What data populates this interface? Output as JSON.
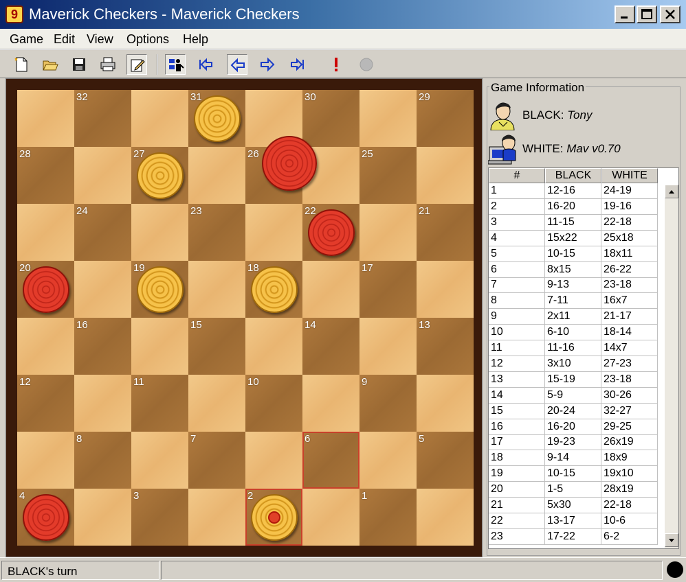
{
  "window": {
    "title": "Maverick Checkers - Maverick Checkers",
    "app_icon_letter": "9"
  },
  "menu": [
    "Game",
    "Edit",
    "View",
    "Options",
    "Help"
  ],
  "toolbar": {
    "buttons": [
      "new-document-icon",
      "open-folder-icon",
      "save-disk-icon",
      "print-icon",
      "edit-icon",
      "setup-pieces-icon",
      "first-move-icon",
      "back-move-icon",
      "forward-move-icon",
      "last-move-icon",
      "alert-icon",
      "stop-icon"
    ],
    "colors": {
      "arrow": "#1a3cc8",
      "alert": "#cc0000",
      "stop": "#b0b0b0"
    }
  },
  "board": {
    "size": 8,
    "colors": {
      "light": "#f2c98a",
      "dark": "#a6703a",
      "red_piece": "#e33b2a",
      "yellow_piece": "#f6c24a",
      "highlight": "#c8402a"
    },
    "squares": [
      {
        "n": 32,
        "row": 0,
        "col": 1
      },
      {
        "n": 31,
        "row": 0,
        "col": 3
      },
      {
        "n": 30,
        "row": 0,
        "col": 5
      },
      {
        "n": 29,
        "row": 0,
        "col": 7
      },
      {
        "n": 28,
        "row": 1,
        "col": 0
      },
      {
        "n": 27,
        "row": 1,
        "col": 2
      },
      {
        "n": 26,
        "row": 1,
        "col": 4
      },
      {
        "n": 25,
        "row": 1,
        "col": 6
      },
      {
        "n": 24,
        "row": 2,
        "col": 1
      },
      {
        "n": 23,
        "row": 2,
        "col": 3
      },
      {
        "n": 22,
        "row": 2,
        "col": 5
      },
      {
        "n": 21,
        "row": 2,
        "col": 7
      },
      {
        "n": 20,
        "row": 3,
        "col": 0
      },
      {
        "n": 19,
        "row": 3,
        "col": 2
      },
      {
        "n": 18,
        "row": 3,
        "col": 4
      },
      {
        "n": 17,
        "row": 3,
        "col": 6
      },
      {
        "n": 16,
        "row": 4,
        "col": 1
      },
      {
        "n": 15,
        "row": 4,
        "col": 3
      },
      {
        "n": 14,
        "row": 4,
        "col": 5
      },
      {
        "n": 13,
        "row": 4,
        "col": 7
      },
      {
        "n": 12,
        "row": 5,
        "col": 0
      },
      {
        "n": 11,
        "row": 5,
        "col": 2
      },
      {
        "n": 10,
        "row": 5,
        "col": 4
      },
      {
        "n": 9,
        "row": 5,
        "col": 6
      },
      {
        "n": 8,
        "row": 6,
        "col": 1
      },
      {
        "n": 7,
        "row": 6,
        "col": 3
      },
      {
        "n": 6,
        "row": 6,
        "col": 5
      },
      {
        "n": 5,
        "row": 6,
        "col": 7
      },
      {
        "n": 4,
        "row": 7,
        "col": 0
      },
      {
        "n": 3,
        "row": 7,
        "col": 2
      },
      {
        "n": 2,
        "row": 7,
        "col": 4
      },
      {
        "n": 1,
        "row": 7,
        "col": 6
      }
    ],
    "highlighted_squares": [
      6,
      2
    ],
    "pieces": [
      {
        "square": 31,
        "color": "yellow"
      },
      {
        "square": 27,
        "color": "yellow"
      },
      {
        "square": 26,
        "color": "red",
        "lifted": true
      },
      {
        "square": 22,
        "color": "red"
      },
      {
        "square": 20,
        "color": "red"
      },
      {
        "square": 19,
        "color": "yellow"
      },
      {
        "square": 18,
        "color": "yellow"
      },
      {
        "square": 4,
        "color": "red"
      },
      {
        "square": 2,
        "color": "yellow",
        "marked": true
      }
    ]
  },
  "game_info": {
    "title": "Game Information",
    "black_label": "BLACK:",
    "black_name": "Tony",
    "white_label": "WHITE:",
    "white_name": "Mav v0.70"
  },
  "moves": {
    "headers": [
      "#",
      "BLACK",
      "WHITE"
    ],
    "rows": [
      [
        "1",
        "12-16",
        "24-19"
      ],
      [
        "2",
        "16-20",
        "19-16"
      ],
      [
        "3",
        "11-15",
        "22-18"
      ],
      [
        "4",
        "15x22",
        "25x18"
      ],
      [
        "5",
        "10-15",
        "18x11"
      ],
      [
        "6",
        "8x15",
        "26-22"
      ],
      [
        "7",
        "9-13",
        "23-18"
      ],
      [
        "8",
        "7-11",
        "16x7"
      ],
      [
        "9",
        "2x11",
        "21-17"
      ],
      [
        "10",
        "6-10",
        "18-14"
      ],
      [
        "11",
        "11-16",
        "14x7"
      ],
      [
        "12",
        "3x10",
        "27-23"
      ],
      [
        "13",
        "15-19",
        "23-18"
      ],
      [
        "14",
        "5-9",
        "30-26"
      ],
      [
        "15",
        "20-24",
        "32-27"
      ],
      [
        "16",
        "16-20",
        "29-25"
      ],
      [
        "17",
        "19-23",
        "26x19"
      ],
      [
        "18",
        "9-14",
        "18x9"
      ],
      [
        "19",
        "10-15",
        "19x10"
      ],
      [
        "20",
        "1-5",
        "28x19"
      ],
      [
        "21",
        "5x30",
        "22-18"
      ],
      [
        "22",
        "13-17",
        "10-6"
      ],
      [
        "23",
        "17-22",
        "6-2"
      ]
    ]
  },
  "status": {
    "text": "BLACK's turn",
    "indicator_color": "#000000"
  }
}
